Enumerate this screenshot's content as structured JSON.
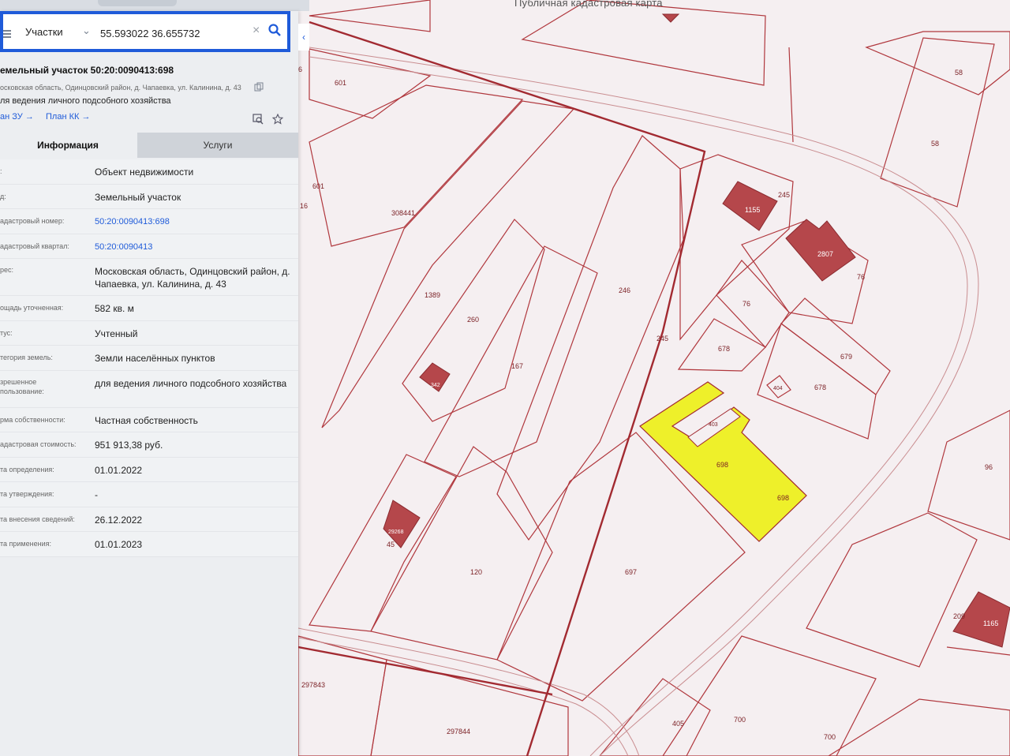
{
  "header": {
    "page_title": "Публичная кадастровая карта"
  },
  "search": {
    "category": "Участки",
    "query": "55.593022 36.655732"
  },
  "object": {
    "title": "емельный участок 50:20:0090413:698",
    "address_short": "осковская область, Одинцовский район, д. Чапаевка, ул. Калинина, д. 43",
    "usage_short": "ля ведения личного подсобного хозяйства",
    "link_plan_zu": "ан ЗУ →",
    "link_plan_kk": "План КК →"
  },
  "tabs": [
    {
      "label": "Информация",
      "active": true
    },
    {
      "label": "Услуги",
      "active": false
    }
  ],
  "info_rows": [
    {
      "key": ":",
      "value": "Объект недвижимости"
    },
    {
      "key": "д:",
      "value": "Земельный участок"
    },
    {
      "key": "адастровый номер:",
      "value": "50:20:0090413:698",
      "link": true
    },
    {
      "key": "адастровый квартал:",
      "value": "50:20:0090413",
      "link": true
    },
    {
      "key": "рес:",
      "value": "Московская область, Одинцовский район, д. Чапаевка, ул. Калинина, д. 43",
      "tall": true
    },
    {
      "key": "ощадь уточненная:",
      "value": "582 кв. м"
    },
    {
      "key": "тус:",
      "value": "Учтенный"
    },
    {
      "key": "тегория земель:",
      "value": "Земли населённых пунктов"
    },
    {
      "key": "зрешенное\nпользование:",
      "value": "для ведения личного подсобного хозяйства",
      "tall": true
    },
    {
      "key": "рма собственности:",
      "value": "Частная собственность"
    },
    {
      "key": "адастровая стоимость:",
      "value": "951 913,38 руб."
    },
    {
      "key": "та определения:",
      "value": "01.01.2022"
    },
    {
      "key": "та утверждения:",
      "value": "-"
    },
    {
      "key": "та внесения сведений:",
      "value": "26.12.2022"
    },
    {
      "key": "та применения:",
      "value": "01.01.2023"
    }
  ],
  "map_labels": [
    "601",
    "6",
    "16",
    "308441",
    "1389",
    "260",
    "167",
    "246",
    "245",
    "1155",
    "2807",
    "76",
    "678",
    "679",
    "404",
    "403",
    "698",
    "58",
    "96",
    "697",
    "120",
    "45",
    "297843",
    "297844",
    "405",
    "700",
    "209",
    "1165",
    "342",
    "29268"
  ],
  "colors": {
    "accent": "#1f5bd9",
    "parcel_line": "#b0373d",
    "selected_fill": "#eef02a",
    "building_fill": "#b5474b"
  }
}
